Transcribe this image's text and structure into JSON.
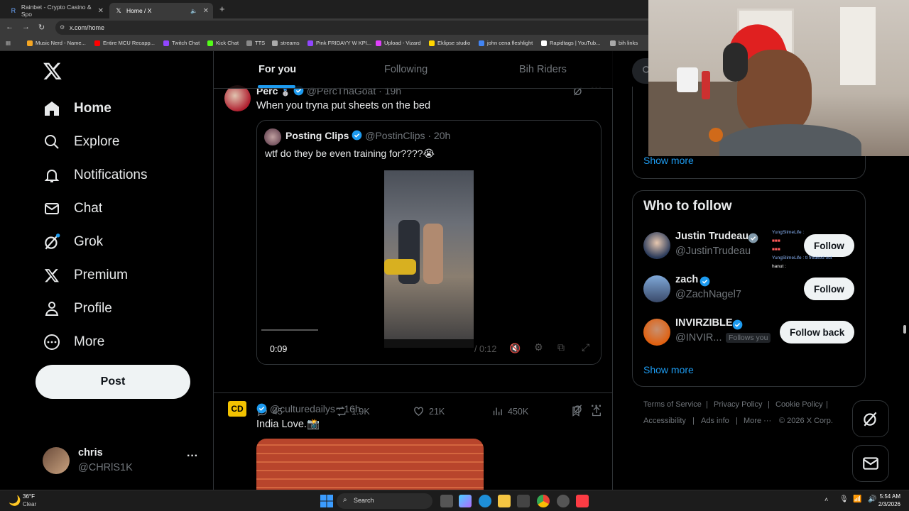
{
  "browser": {
    "tabs": [
      {
        "label": "Rainbet - Crypto Casino & Spo",
        "active": false
      },
      {
        "label": "Home / X",
        "active": true
      }
    ],
    "url": "x.com/home",
    "bookmarks": [
      "Music Nerd - Name...",
      "Entire MCU Recapp...",
      "Twitch Chat",
      "Kick Chat",
      "TTS",
      "streams",
      "Pink FRIDAYY W KPI...",
      "Upload - Vizard",
      "Eklipse studio",
      "john cena fleshlight",
      "Rapidtags | YouTub...",
      "bih links"
    ]
  },
  "sidebar": {
    "items": [
      {
        "label": "Home",
        "icon": "home-icon"
      },
      {
        "label": "Explore",
        "icon": "search-icon"
      },
      {
        "label": "Notifications",
        "icon": "bell-icon"
      },
      {
        "label": "Chat",
        "icon": "mail-icon"
      },
      {
        "label": "Grok",
        "icon": "grok-icon"
      },
      {
        "label": "Premium",
        "icon": "x-logo-icon"
      },
      {
        "label": "Profile",
        "icon": "person-icon"
      },
      {
        "label": "More",
        "icon": "more-circle-icon"
      }
    ],
    "post_label": "Post",
    "account": {
      "name": "chris",
      "handle": "@CHRlS1K",
      "more": "···"
    }
  },
  "feed": {
    "tabs": [
      "For you",
      "Following",
      "Bih Riders"
    ],
    "post1": {
      "name": "Perc",
      "handle": "@PercThaGoat",
      "time": "· 19h",
      "text": "When you tryna put sheets on the bed",
      "quote": {
        "name": "Posting Clips",
        "handle": "@PostinClips",
        "time": "· 20h",
        "text": "wtf do they be even training for????😭",
        "video_time": "0:09",
        "video_total": "/ 0:12"
      },
      "actions": {
        "replies": "45",
        "reposts": "1.9K",
        "likes": "21K",
        "views": "450K"
      }
    },
    "post2": {
      "handle": "@culturedailys",
      "time": "· 16h",
      "text": "India Love.📸",
      "avatar_text": "CD"
    }
  },
  "right": {
    "trends_show_more": "Show more",
    "who_to_follow": {
      "title": "Who to follow",
      "users": [
        {
          "name": "Justin Trudeau",
          "handle": "@JustinTrudeau",
          "button": "Follow"
        },
        {
          "name": "zach",
          "handle": "@ZachNagel7",
          "button": "Follow"
        },
        {
          "name": "INVIRZIBLE",
          "handle": "@INVIR...",
          "badge": "Follows you",
          "button": "Follow back"
        }
      ],
      "show_more": "Show more"
    },
    "footer": [
      "Terms of Service",
      "Privacy Policy",
      "Cookie Policy",
      "Accessibility",
      "Ads info",
      "More ···",
      "© 2026 X Corp."
    ],
    "chat_overlay": [
      "YungSlimeLife :",
      "YungSlimeLife : tl freaked out",
      "hanut :"
    ]
  },
  "taskbar": {
    "weather_temp": "36°F",
    "weather_desc": "Clear",
    "search": "Search",
    "time": "5:54 AM",
    "date": "2/3/2026"
  },
  "colors": {
    "accent": "#1d9bf0",
    "bg": "#000000",
    "border": "#2f3336",
    "muted": "#71767b"
  }
}
